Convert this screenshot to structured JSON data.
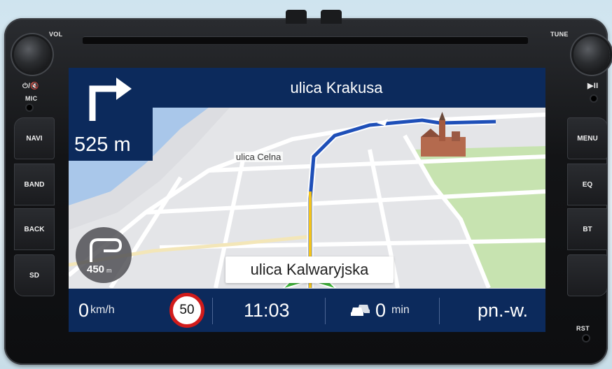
{
  "device": {
    "vol_label": "VOL",
    "tune_label": "TUNE",
    "mute_label": "⏻/🔇",
    "mic_label": "MIC",
    "play_pause_label": "▶II",
    "rst_label": "RST",
    "left_buttons": [
      "NAVI",
      "BAND",
      "BACK",
      "SD"
    ],
    "right_buttons": [
      "MENU",
      "EQ",
      "BT"
    ]
  },
  "navigation": {
    "next_street": "ulica Krakusa",
    "turn_direction": "right",
    "turn_distance": "525 m",
    "map_street_label": "ulica  Celna",
    "current_street": "ulica Kalwaryjska",
    "roundabout_distance": "450",
    "roundabout_unit": "m"
  },
  "status_bar": {
    "speed_value": "0",
    "speed_unit": "km/h",
    "speed_limit": "50",
    "clock": "11:03",
    "traffic_delay_value": "0",
    "traffic_delay_unit": "min",
    "day": "pn.-w."
  },
  "colors": {
    "header_navy": "#0c2a5c",
    "route_blue": "#1e4fb8",
    "route_yellow": "#f2c21b",
    "park_green": "#bfe0a6",
    "position_arrow_green": "#3fb53a",
    "speed_limit_red": "#d11b1b"
  }
}
